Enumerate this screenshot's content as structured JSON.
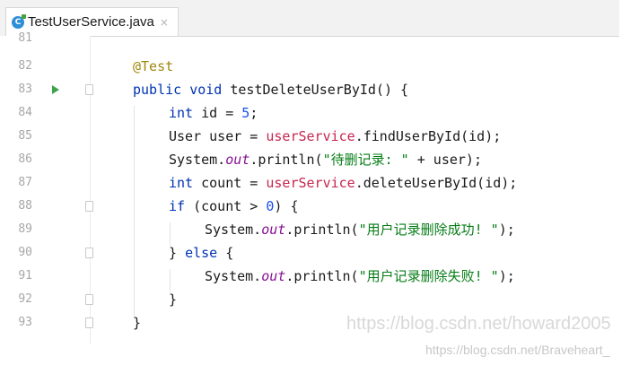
{
  "tab": {
    "icon": "C",
    "filename": "TestUserService.java",
    "close": "×"
  },
  "lines": [
    {
      "num": "81"
    },
    {
      "num": "82"
    },
    {
      "num": "83"
    },
    {
      "num": "84"
    },
    {
      "num": "85"
    },
    {
      "num": "86"
    },
    {
      "num": "87"
    },
    {
      "num": "88"
    },
    {
      "num": "89"
    },
    {
      "num": "90"
    },
    {
      "num": "91"
    },
    {
      "num": "92"
    },
    {
      "num": "93"
    }
  ],
  "code": {
    "l82": {
      "annotation": "@Test"
    },
    "l83": {
      "kw1": "public",
      "kw2": "void",
      "rest": " testDeleteUserById() {"
    },
    "l84": {
      "kw": "int",
      "rest1": " id = ",
      "num": "5",
      "rest2": ";"
    },
    "l85": {
      "pre": "User user = ",
      "svc": "userService",
      "post": ".findUserById(id);"
    },
    "l86": {
      "pre": "System.",
      "field": "out",
      "mid": ".println(",
      "str": "\"待删记录: \"",
      "post": " + user);"
    },
    "l87": {
      "kw": "int",
      "pre": " count = ",
      "svc": "userService",
      "post": ".deleteUserById(id);"
    },
    "l88": {
      "kw": "if",
      "pre": " (count > ",
      "num": "0",
      "post": ") {"
    },
    "l89": {
      "pre": "System.",
      "field": "out",
      "mid": ".println(",
      "str": "\"用户记录删除成功! \"",
      "post": ");"
    },
    "l90": {
      "pre": "} ",
      "kw": "else",
      "post": " {"
    },
    "l91": {
      "pre": "System.",
      "field": "out",
      "mid": ".println(",
      "str": "\"用户记录删除失败! \"",
      "post": ");"
    },
    "l92": {
      "text": "}"
    },
    "l93": {
      "text": "}"
    }
  },
  "watermarks": {
    "primary": "https://blog.csdn.net/howard2005",
    "secondary": "https://blog.csdn.net/Braveheart_"
  }
}
